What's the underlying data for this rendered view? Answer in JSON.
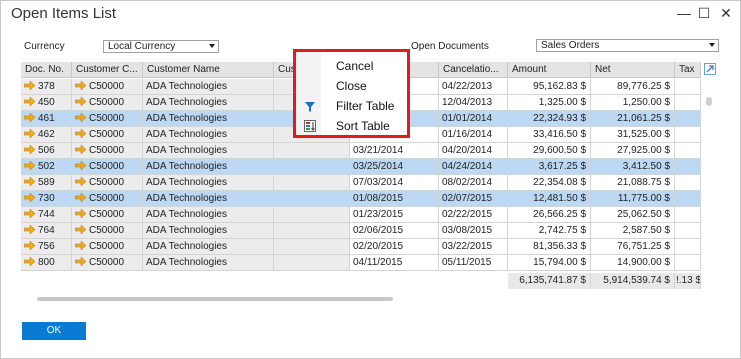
{
  "window": {
    "title": "Open Items List",
    "minimize_glyph": "—",
    "maximize_glyph": "☐",
    "close_glyph": "✕"
  },
  "criteria": {
    "currency_label": "Currency",
    "currency_value": "Local Currency",
    "documents_label": "Open Documents",
    "documents_value": "Sales Orders"
  },
  "columns": [
    "Doc. No.",
    "Customer C...",
    "Customer Name",
    "Cus",
    "",
    "Cancelatio...",
    "Amount",
    "Net",
    "Tax"
  ],
  "rows": [
    {
      "doc": "378",
      "code": "C50000",
      "name": "ADA Technologies",
      "date": "",
      "cancel": "04/22/2013",
      "amount": "95,162.83 $",
      "net": "89,776.25 $",
      "selected": false
    },
    {
      "doc": "450",
      "code": "C50000",
      "name": "ADA Technologies",
      "date": "",
      "cancel": "12/04/2013",
      "amount": "1,325.00 $",
      "net": "1,250.00 $",
      "selected": false
    },
    {
      "doc": "461",
      "code": "C50000",
      "name": "ADA Technologies",
      "date": "",
      "cancel": "01/01/2014",
      "amount": "22,324.93 $",
      "net": "21,061.25 $",
      "selected": true
    },
    {
      "doc": "462",
      "code": "C50000",
      "name": "ADA Technologies",
      "date": "",
      "cancel": "01/16/2014",
      "amount": "33,416.50 $",
      "net": "31,525.00 $",
      "selected": false
    },
    {
      "doc": "506",
      "code": "C50000",
      "name": "ADA Technologies",
      "date": "03/21/2014",
      "cancel": "04/20/2014",
      "amount": "29,600.50 $",
      "net": "27,925.00 $",
      "selected": false
    },
    {
      "doc": "502",
      "code": "C50000",
      "name": "ADA Technologies",
      "date": "03/25/2014",
      "cancel": "04/24/2014",
      "amount": "3,617.25 $",
      "net": "3,412.50 $",
      "selected": true
    },
    {
      "doc": "589",
      "code": "C50000",
      "name": "ADA Technologies",
      "date": "07/03/2014",
      "cancel": "08/02/2014",
      "amount": "22,354.08 $",
      "net": "21,088.75 $",
      "selected": false
    },
    {
      "doc": "730",
      "code": "C50000",
      "name": "ADA Technologies",
      "date": "01/08/2015",
      "cancel": "02/07/2015",
      "amount": "12,481.50 $",
      "net": "11,775.00 $",
      "selected": true
    },
    {
      "doc": "744",
      "code": "C50000",
      "name": "ADA Technologies",
      "date": "01/23/2015",
      "cancel": "02/22/2015",
      "amount": "26,566.25 $",
      "net": "25,062.50 $",
      "selected": false
    },
    {
      "doc": "764",
      "code": "C50000",
      "name": "ADA Technologies",
      "date": "02/06/2015",
      "cancel": "03/08/2015",
      "amount": "2,742.75 $",
      "net": "2,587.50 $",
      "selected": false
    },
    {
      "doc": "756",
      "code": "C50000",
      "name": "ADA Technologies",
      "date": "02/20/2015",
      "cancel": "03/22/2015",
      "amount": "81,356.33 $",
      "net": "76,751.25 $",
      "selected": false
    },
    {
      "doc": "800",
      "code": "C50000",
      "name": "ADA Technologies",
      "date": "04/11/2015",
      "cancel": "05/11/2015",
      "amount": "15,794.00 $",
      "net": "14,900.00 $",
      "selected": false
    }
  ],
  "totals": {
    "amount": "6,135,741.87 $",
    "net": "5,914,539.74 $",
    "tax": "!.13 $"
  },
  "context_menu": {
    "cancel": "Cancel",
    "close": "Close",
    "filter": "Filter Table",
    "sort": "Sort Table"
  },
  "buttons": {
    "ok": "OK"
  },
  "colors": {
    "accent": "#0a7bd4",
    "selected_row": "#bcd8f3",
    "link_arrow": "#f0a81e",
    "menu_border": "#e01b22"
  },
  "icons": [
    "link-arrow-icon",
    "filter-icon",
    "sort-icon",
    "expand-icon"
  ]
}
